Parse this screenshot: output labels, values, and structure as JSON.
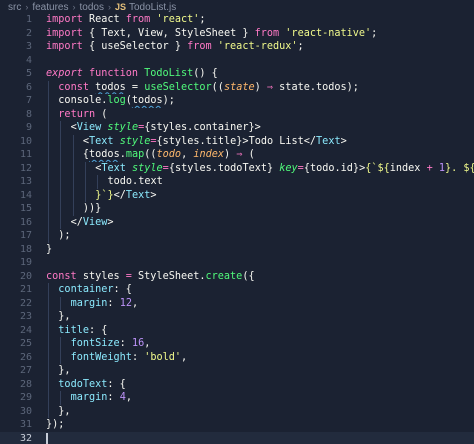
{
  "breadcrumb": {
    "items": [
      "src",
      "features",
      "todos"
    ],
    "file_badge": "JS",
    "file_name": "TodoList.js"
  },
  "colors": {
    "background": "#1b2232",
    "keyword": "#ff79c6",
    "string": "#f1fa8c",
    "function": "#50fa7b",
    "variable": "#f8f8f2",
    "property": "#8be9fd",
    "number": "#bd93f9",
    "italic_attr": "#50fa7b"
  },
  "editor": {
    "active_line": 32,
    "lines": [
      {
        "n": "1",
        "tokens": [
          [
            "import ",
            "kw"
          ],
          [
            "React ",
            "v"
          ],
          [
            "from ",
            "kw"
          ],
          [
            "'react'",
            "s"
          ],
          [
            ";",
            "p"
          ]
        ]
      },
      {
        "n": "2",
        "tokens": [
          [
            "import ",
            "kw"
          ],
          [
            "{ ",
            "p"
          ],
          [
            "Text",
            "v"
          ],
          [
            ", ",
            "p"
          ],
          [
            "View",
            "v"
          ],
          [
            ", ",
            "p"
          ],
          [
            "StyleSheet ",
            "v"
          ],
          [
            "} ",
            "p"
          ],
          [
            "from ",
            "kw"
          ],
          [
            "'react-native'",
            "s"
          ],
          [
            ";",
            "p"
          ]
        ]
      },
      {
        "n": "3",
        "tokens": [
          [
            "import ",
            "kw"
          ],
          [
            "{ ",
            "p"
          ],
          [
            "useSelector ",
            "v"
          ],
          [
            "} ",
            "p"
          ],
          [
            "from ",
            "kw"
          ],
          [
            "'react-redux'",
            "s"
          ],
          [
            ";",
            "p"
          ]
        ]
      },
      {
        "n": "4",
        "tokens": []
      },
      {
        "n": "5",
        "tokens": [
          [
            "export ",
            "kwi"
          ],
          [
            "function ",
            "kw"
          ],
          [
            "TodoList",
            "fn"
          ],
          [
            "() {",
            "p"
          ]
        ]
      },
      {
        "n": "6",
        "indent": 1,
        "tokens": [
          [
            "const ",
            "kw"
          ],
          [
            "todos",
            "vsq"
          ],
          [
            " = ",
            "p"
          ],
          [
            "useSelector",
            "fn"
          ],
          [
            "((",
            "p"
          ],
          [
            "state",
            "param"
          ],
          [
            ") ",
            "p"
          ],
          [
            "⇒ ",
            "kw"
          ],
          [
            "state",
            "v"
          ],
          [
            ".",
            "p"
          ],
          [
            "todos",
            "v"
          ],
          [
            ");",
            "p"
          ]
        ]
      },
      {
        "n": "7",
        "indent": 1,
        "tokens": [
          [
            "console",
            "v"
          ],
          [
            ".",
            "p"
          ],
          [
            "log",
            "fn"
          ],
          [
            "(",
            "p"
          ],
          [
            "todos",
            "vsq"
          ],
          [
            ");",
            "p"
          ]
        ]
      },
      {
        "n": "8",
        "indent": 1,
        "tokens": [
          [
            "return ",
            "kw"
          ],
          [
            "(",
            "p"
          ]
        ]
      },
      {
        "n": "9",
        "indent": 2,
        "tokens": [
          [
            "<",
            "p"
          ],
          [
            "View ",
            "tag"
          ],
          [
            "style",
            "attr"
          ],
          [
            "=",
            "kw"
          ],
          [
            "{",
            "p"
          ],
          [
            "styles",
            "v"
          ],
          [
            ".",
            "p"
          ],
          [
            "container",
            "v"
          ],
          [
            "}",
            "p"
          ],
          [
            ">",
            "p"
          ]
        ]
      },
      {
        "n": "10",
        "indent": 3,
        "tokens": [
          [
            "<",
            "p"
          ],
          [
            "Text ",
            "tag"
          ],
          [
            "style",
            "attr"
          ],
          [
            "=",
            "kw"
          ],
          [
            "{",
            "p"
          ],
          [
            "styles",
            "v"
          ],
          [
            ".",
            "p"
          ],
          [
            "title",
            "v"
          ],
          [
            "}",
            "p"
          ],
          [
            ">",
            "p"
          ],
          [
            "Todo List",
            "v"
          ],
          [
            "</",
            "p"
          ],
          [
            "Text",
            "tag"
          ],
          [
            ">",
            "p"
          ]
        ]
      },
      {
        "n": "11",
        "indent": 3,
        "tokens": [
          [
            "{",
            "p"
          ],
          [
            "todos",
            "vsq"
          ],
          [
            ".",
            "p"
          ],
          [
            "map",
            "fn"
          ],
          [
            "((",
            "p"
          ],
          [
            "todo",
            "param"
          ],
          [
            ", ",
            "p"
          ],
          [
            "index",
            "param"
          ],
          [
            ") ",
            "p"
          ],
          [
            "⇒ ",
            "kw"
          ],
          [
            "(",
            "p"
          ]
        ]
      },
      {
        "n": "12",
        "indent": 4,
        "tokens": [
          [
            "<",
            "p"
          ],
          [
            "Text ",
            "tag"
          ],
          [
            "style",
            "attr"
          ],
          [
            "=",
            "kw"
          ],
          [
            "{",
            "p"
          ],
          [
            "styles",
            "v"
          ],
          [
            ".",
            "p"
          ],
          [
            "todoText",
            "v"
          ],
          [
            "} ",
            "p"
          ],
          [
            "key",
            "attr"
          ],
          [
            "=",
            "kw"
          ],
          [
            "{",
            "p"
          ],
          [
            "todo",
            "v"
          ],
          [
            ".",
            "p"
          ],
          [
            "id",
            "v"
          ],
          [
            "}",
            "p"
          ],
          [
            ">",
            "p"
          ],
          [
            "{`${",
            "s"
          ],
          [
            "index ",
            "v"
          ],
          [
            "+ ",
            "kw"
          ],
          [
            "1",
            "num"
          ],
          [
            "}. ${",
            "s"
          ]
        ]
      },
      {
        "n": "13",
        "indent": 5,
        "tokens": [
          [
            "todo",
            "v"
          ],
          [
            ".",
            "p"
          ],
          [
            "text",
            "v"
          ]
        ]
      },
      {
        "n": "14",
        "indent": 4,
        "tokens": [
          [
            "}`}",
            "s"
          ],
          [
            "</",
            "p"
          ],
          [
            "Text",
            "tag"
          ],
          [
            ">",
            "p"
          ]
        ]
      },
      {
        "n": "15",
        "indent": 3,
        "tokens": [
          [
            "))}",
            "p"
          ]
        ]
      },
      {
        "n": "16",
        "indent": 2,
        "tokens": [
          [
            "</",
            "p"
          ],
          [
            "View",
            "tag"
          ],
          [
            ">",
            "p"
          ]
        ]
      },
      {
        "n": "17",
        "indent": 1,
        "tokens": [
          [
            ");",
            "p"
          ]
        ]
      },
      {
        "n": "18",
        "tokens": [
          [
            "}",
            "p"
          ]
        ]
      },
      {
        "n": "19",
        "tokens": []
      },
      {
        "n": "20",
        "tokens": [
          [
            "const ",
            "kw"
          ],
          [
            "styles ",
            "v"
          ],
          [
            "= ",
            "kw"
          ],
          [
            "StyleSheet",
            "v"
          ],
          [
            ".",
            "p"
          ],
          [
            "create",
            "fn"
          ],
          [
            "({",
            "p"
          ]
        ]
      },
      {
        "n": "21",
        "indent": 1,
        "tokens": [
          [
            "container",
            "prop"
          ],
          [
            ": {",
            "p"
          ]
        ]
      },
      {
        "n": "22",
        "indent": 2,
        "tokens": [
          [
            "margin",
            "prop"
          ],
          [
            ": ",
            "p"
          ],
          [
            "12",
            "num"
          ],
          [
            ",",
            "p"
          ]
        ]
      },
      {
        "n": "23",
        "indent": 1,
        "tokens": [
          [
            "},",
            "p"
          ]
        ]
      },
      {
        "n": "24",
        "indent": 1,
        "tokens": [
          [
            "title",
            "prop"
          ],
          [
            ": {",
            "p"
          ]
        ]
      },
      {
        "n": "25",
        "indent": 2,
        "tokens": [
          [
            "fontSize",
            "prop"
          ],
          [
            ": ",
            "p"
          ],
          [
            "16",
            "num"
          ],
          [
            ",",
            "p"
          ]
        ]
      },
      {
        "n": "26",
        "indent": 2,
        "tokens": [
          [
            "fontWeight",
            "prop"
          ],
          [
            ": ",
            "p"
          ],
          [
            "'bold'",
            "s"
          ],
          [
            ",",
            "p"
          ]
        ]
      },
      {
        "n": "27",
        "indent": 1,
        "tokens": [
          [
            "},",
            "p"
          ]
        ]
      },
      {
        "n": "28",
        "indent": 1,
        "tokens": [
          [
            "todoText",
            "prop"
          ],
          [
            ": {",
            "p"
          ]
        ]
      },
      {
        "n": "29",
        "indent": 2,
        "tokens": [
          [
            "margin",
            "prop"
          ],
          [
            ": ",
            "p"
          ],
          [
            "4",
            "num"
          ],
          [
            ",",
            "p"
          ]
        ]
      },
      {
        "n": "30",
        "indent": 1,
        "tokens": [
          [
            "},",
            "p"
          ]
        ]
      },
      {
        "n": "31",
        "tokens": [
          [
            "});",
            "p"
          ]
        ]
      },
      {
        "n": "32",
        "tokens": []
      }
    ]
  }
}
